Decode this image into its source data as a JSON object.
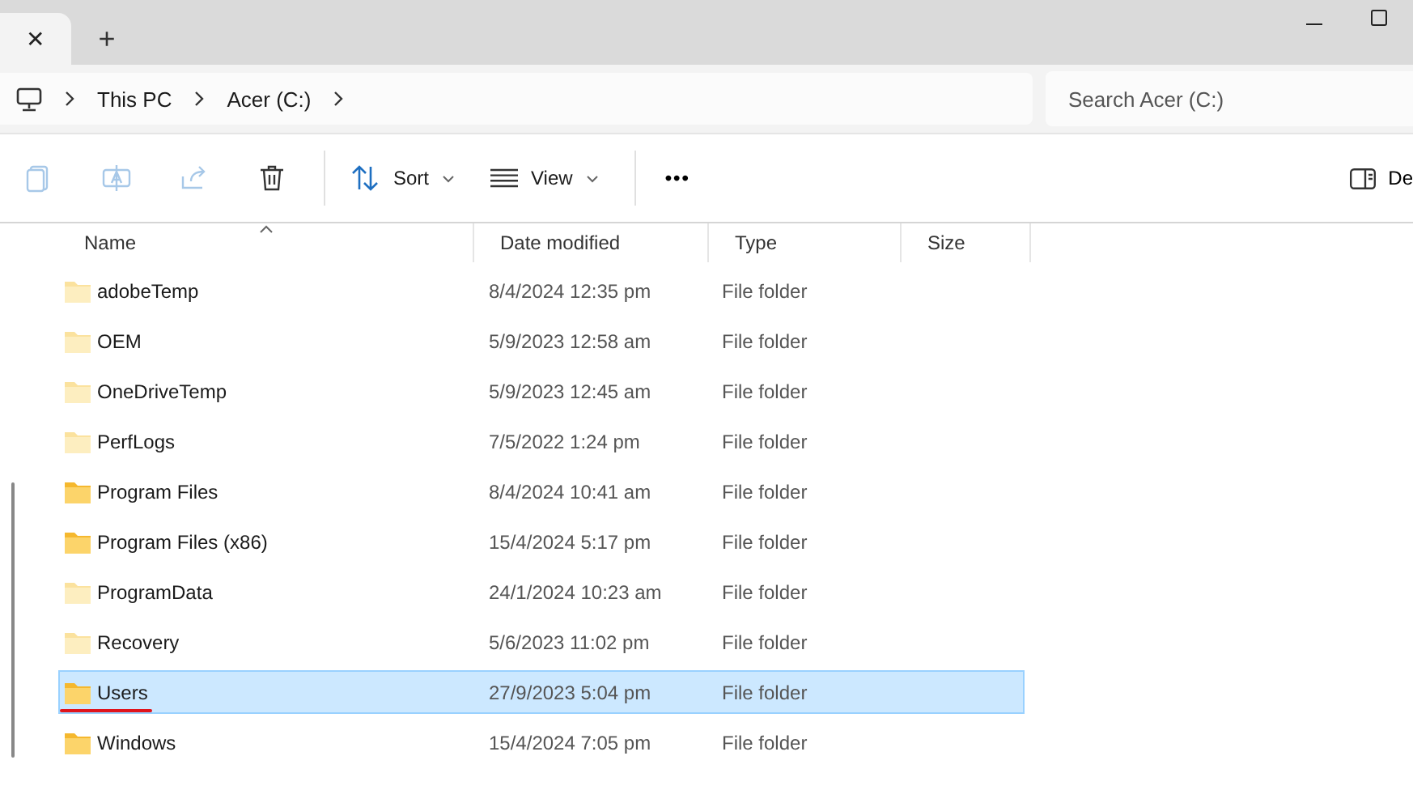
{
  "tab_bar": {
    "close_tab": "✕",
    "new_tab": "+"
  },
  "address_bar": {
    "breadcrumbs": [
      "This PC",
      "Acer (C:)"
    ]
  },
  "search": {
    "placeholder": "Search Acer (C:)"
  },
  "command_bar": {
    "actions": [
      {
        "kind": "copy",
        "disabled": true
      },
      {
        "kind": "rename",
        "disabled": true
      },
      {
        "kind": "share",
        "disabled": true
      },
      {
        "kind": "delete",
        "disabled": false
      }
    ],
    "sort": "Sort",
    "view": "View",
    "more": "•••",
    "details": "De"
  },
  "table": {
    "columns": [
      {
        "label": "Name",
        "sorted": true
      },
      {
        "label": "Date modified",
        "sorted": false
      },
      {
        "label": "Type",
        "sorted": false
      },
      {
        "label": "Size",
        "sorted": false
      }
    ],
    "rows": [
      {
        "name": "adobeTemp",
        "date": "8/4/2024 12:35 pm",
        "type": "File folder",
        "hidden": true,
        "selected": false,
        "underlined": false
      },
      {
        "name": "OEM",
        "date": "5/9/2023 12:58 am",
        "type": "File folder",
        "hidden": true,
        "selected": false,
        "underlined": false
      },
      {
        "name": "OneDriveTemp",
        "date": "5/9/2023 12:45 am",
        "type": "File folder",
        "hidden": true,
        "selected": false,
        "underlined": false
      },
      {
        "name": "PerfLogs",
        "date": "7/5/2022 1:24 pm",
        "type": "File folder",
        "hidden": true,
        "selected": false,
        "underlined": false
      },
      {
        "name": "Program Files",
        "date": "8/4/2024 10:41 am",
        "type": "File folder",
        "hidden": false,
        "selected": false,
        "underlined": false
      },
      {
        "name": "Program Files (x86)",
        "date": "15/4/2024 5:17 pm",
        "type": "File folder",
        "hidden": false,
        "selected": false,
        "underlined": false
      },
      {
        "name": "ProgramData",
        "date": "24/1/2024 10:23 am",
        "type": "File folder",
        "hidden": true,
        "selected": false,
        "underlined": false
      },
      {
        "name": "Recovery",
        "date": "5/6/2023 11:02 pm",
        "type": "File folder",
        "hidden": true,
        "selected": false,
        "underlined": false
      },
      {
        "name": "Users",
        "date": "27/9/2023 5:04 pm",
        "type": "File folder",
        "hidden": false,
        "selected": true,
        "underlined": true
      },
      {
        "name": "Windows",
        "date": "15/4/2024 7:05 pm",
        "type": "File folder",
        "hidden": false,
        "selected": false,
        "underlined": false
      }
    ]
  }
}
